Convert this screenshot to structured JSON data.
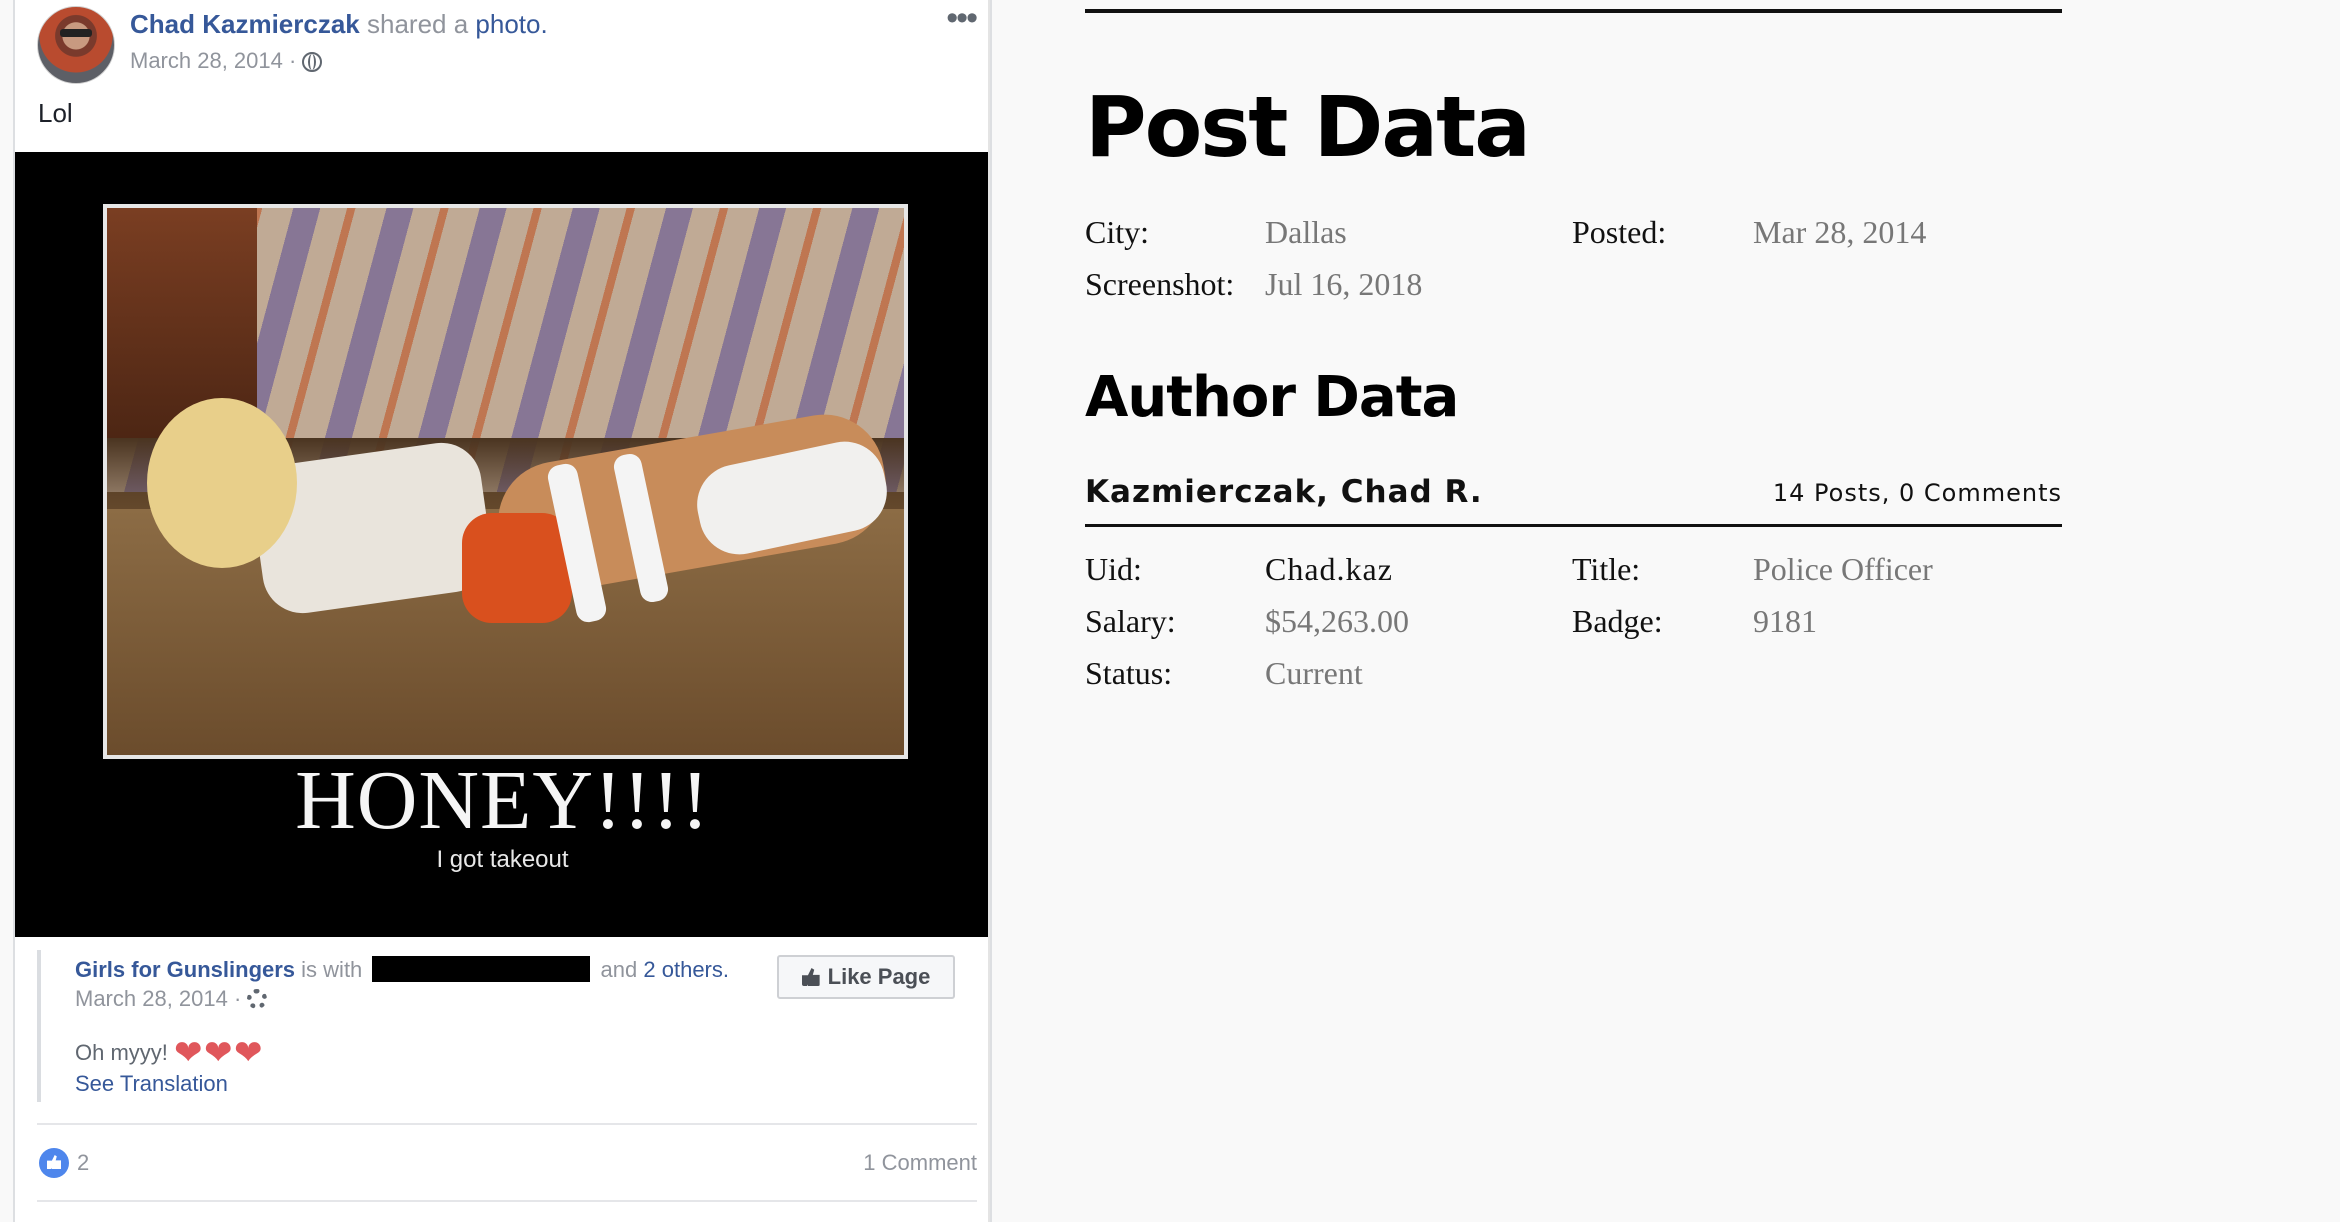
{
  "post": {
    "author_name": "Chad Kazmierczak",
    "shared_text": "shared a",
    "shared_link": "photo.",
    "date": "March 28, 2014 ·",
    "more_icon": "more-horizontal-icon",
    "text": "Lol",
    "photo": {
      "caption": "HONEY!!!!",
      "subcaption": "I got takeout"
    },
    "shared_post": {
      "page_name": "Girls for Gunslingers",
      "with_text": "is with",
      "and_text": "and",
      "others_link": "2 others.",
      "date": "March 28, 2014 ·",
      "like_page_label": "Like Page",
      "text": "Oh myyy!",
      "hearts": [
        "❤",
        "❤",
        "❤"
      ],
      "see_translation": "See Translation"
    },
    "reactions": {
      "like_count": "2",
      "comment_count": "1 Comment"
    }
  },
  "post_data": {
    "heading": "Post Data",
    "fields": [
      {
        "label": "City:",
        "value": "Dallas"
      },
      {
        "label": "Posted:",
        "value": "Mar 28, 2014"
      },
      {
        "label": "Screenshot:",
        "value": "Jul 16, 2018"
      }
    ]
  },
  "author_data": {
    "heading": "Author Data",
    "name": "Kazmierczak, Chad R.",
    "stats": "14 Posts, 0 Comments",
    "fields": [
      {
        "label": "Uid:",
        "value": "Chad.kaz"
      },
      {
        "label": "Title:",
        "value": "Police Officer"
      },
      {
        "label": "Salary:",
        "value": "$54,263.00"
      },
      {
        "label": "Badge:",
        "value": "9181"
      },
      {
        "label": "Status:",
        "value": "Current"
      }
    ]
  },
  "colors": {
    "facebook_link": "#365899",
    "meta_gray": "#90949c",
    "like_blue": "#4e86ec",
    "heart_red": "#e0575b"
  }
}
